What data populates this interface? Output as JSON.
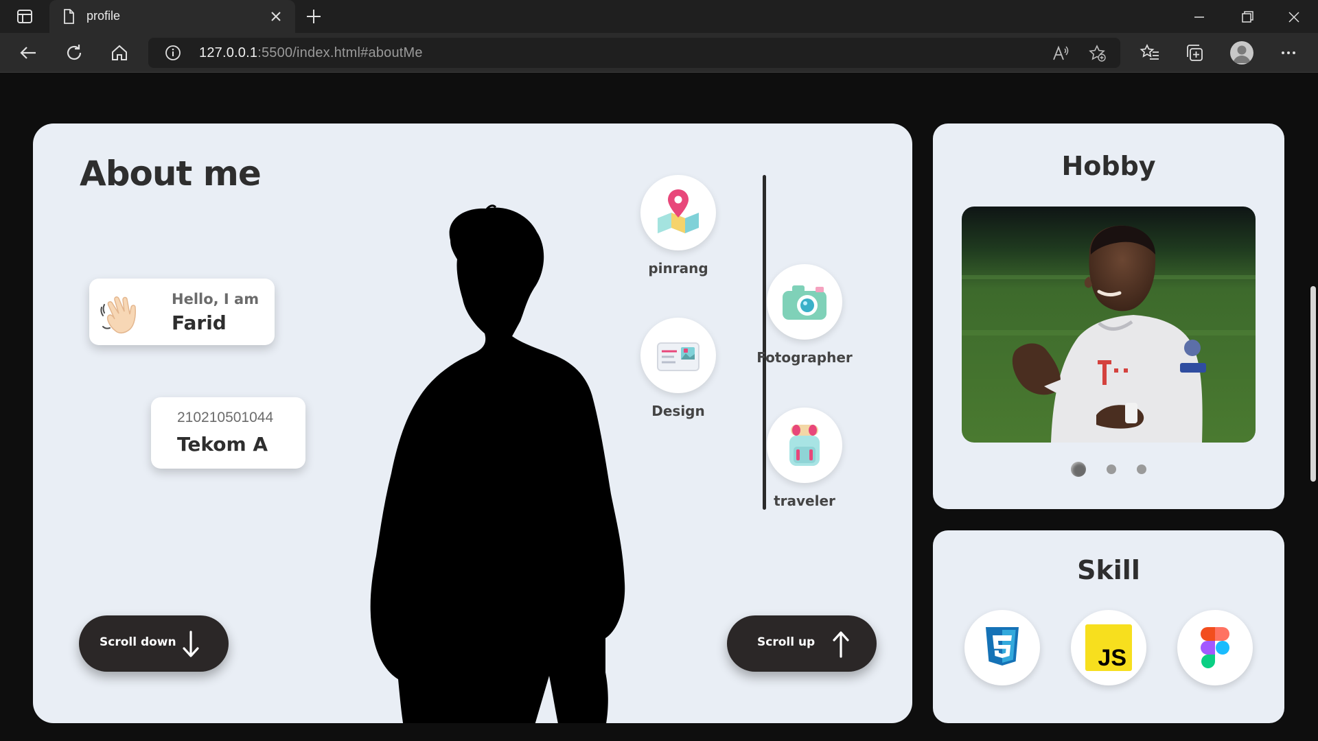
{
  "browser": {
    "tab_title": "profile",
    "url_host": "127.0.0.1",
    "url_rest": ":5500/index.html#aboutMe"
  },
  "about": {
    "title": "About me",
    "greeting": "Hello, I am",
    "name": "Farid",
    "student_id": "210210501044",
    "class_name": "Tekom A",
    "hobbies": [
      {
        "label": "pinrang",
        "icon": "map-pin-icon"
      },
      {
        "label": "Design",
        "icon": "postcard-icon"
      },
      {
        "label": "Fotographer",
        "icon": "camera-icon"
      },
      {
        "label": "traveler",
        "icon": "backpack-icon"
      }
    ],
    "scroll_down": "Scroll down",
    "scroll_up": "Scroll up"
  },
  "hobby_panel": {
    "title": "Hobby",
    "carousel_total": 3,
    "carousel_active": 1
  },
  "skill_panel": {
    "title": "Skill",
    "skills": [
      "css3-icon",
      "javascript-icon",
      "figma-icon"
    ]
  },
  "colors": {
    "card_bg": "#e9eef5",
    "page_bg": "#0e0e0e",
    "pill_bg": "#2b2727",
    "text_dark": "#2e2e2e"
  }
}
